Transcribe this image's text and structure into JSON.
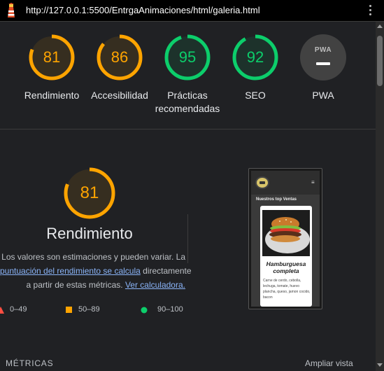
{
  "browser": {
    "url": "http://127.0.0.1:5500/EntrgaAnimaciones/html/galeria.html"
  },
  "categories": [
    {
      "label": "Rendimiento",
      "score": "81",
      "status": "average"
    },
    {
      "label": "Accesibilidad",
      "score": "86",
      "status": "average"
    },
    {
      "label": "Prácticas recomendadas",
      "score": "95",
      "status": "pass"
    },
    {
      "label": "SEO",
      "score": "92",
      "status": "pass"
    },
    {
      "label": "PWA",
      "badge": "PWA",
      "status": "na"
    }
  ],
  "performance": {
    "score": "81",
    "title": "Rendimiento",
    "desc_line1": "Los valores son estimaciones y pueden variar. La",
    "desc_link1": "puntuación del rendimiento se calcula",
    "desc_mid": " directamente",
    "desc_line3_pre": "a partir de estas métricas.",
    "desc_link2": "Ver calculadora.",
    "legend": {
      "fail": "0–49",
      "average": "50–89",
      "pass": "90–100"
    }
  },
  "screenshot": {
    "section_title": "Nuestros top Ventas",
    "card_title": "Hamburguesa completa",
    "card_desc": "Carne de cerdo, cebolla, lechuga, tomate, huevo plancha, queso, jamon cocido, bacon"
  },
  "footer": {
    "metrics_label": "MÉTRICAS",
    "expand_label": "Ampliar vista"
  },
  "colors": {
    "average": "#ffa400",
    "pass": "#0cce6b",
    "fail": "#ff4e42",
    "background": "#202124",
    "link": "#8ab4f8"
  }
}
